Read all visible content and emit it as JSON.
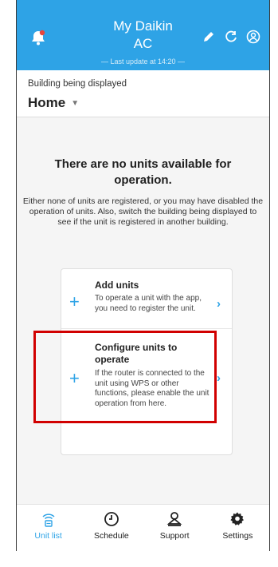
{
  "header": {
    "title_line1": "My Daikin",
    "title_line2": "AC",
    "last_update": "— Last update at 14:20 —"
  },
  "building": {
    "label": "Building being displayed",
    "selected": "Home"
  },
  "empty_state": {
    "title": "There are no units available for operation.",
    "description": "Either none of units are registered, or you may have disabled the operation of units. Also, switch the building being displayed to see if the unit is registered in another building."
  },
  "options": [
    {
      "title": "Add units",
      "description": "To operate a unit with the app, you need to register the unit."
    },
    {
      "title": "Configure units to operate",
      "description": "If the router is connected to the unit using WPS or other functions, please enable the unit operation from here."
    }
  ],
  "tabs": [
    {
      "label": "Unit list",
      "icon": "wifi-unit-icon"
    },
    {
      "label": "Schedule",
      "icon": "clock-icon"
    },
    {
      "label": "Support",
      "icon": "support-icon"
    },
    {
      "label": "Settings",
      "icon": "gear-icon"
    }
  ],
  "colors": {
    "accent": "#2ea3e6",
    "highlight": "#d10000"
  }
}
